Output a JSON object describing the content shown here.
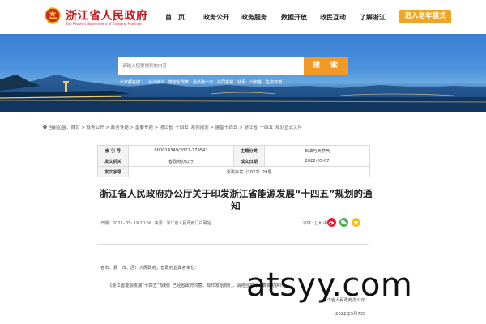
{
  "header": {
    "site_title": "浙江省人民政府",
    "site_subtitle": "The People's Government of Zhejiang Province",
    "nav": [
      "首　页",
      "政务公开",
      "政务服务",
      "数据开放",
      "政民互动",
      "了解浙江"
    ],
    "elder_mode": "进入老年模式"
  },
  "search": {
    "placeholder": "请输入您要搜索的内容",
    "button": "搜　索",
    "hot_label": "大家都在搜：",
    "hot_links": [
      "会计考试",
      "数字化改革",
      "最多跑一次",
      "共同富裕",
      "社保",
      "公积金",
      "生态环境"
    ]
  },
  "breadcrumb": "当前位置：首页 > 政务公开 > 政务专题 > 重要专题 > 浙江省“十四五”系列规划 > 展望十四五 > 浙江省“十四五”规划正式文件",
  "meta": {
    "index_label": "索 引 号",
    "index_value": "000014349/2022-779542",
    "category_label": "主题分类",
    "category_value": "石油与天然气",
    "issuer_label": "发文机关",
    "issuer_value": "省政府办公厅",
    "date_label": "成文日期",
    "date_value": "2022-05-07",
    "number_label": "发文字号",
    "number_value": "浙政办发〔2022〕29号"
  },
  "article": {
    "title": "浙江省人民政府办公厅关于印发浙江省能源发展“十四五”规划的通知",
    "date_info": "日期：2022- 05- 19 10:56",
    "source_info": "来源：浙江省人民政府门户网站",
    "font_size": "字体：[ 大 中 小 ]",
    "salutation": "各市、县（市、区）人民政府，省政府直属各单位：",
    "body": "《浙江省能源发展“十四五”规划》已经省政府同意，现印发给你们，请结合实际认真贯彻执行。",
    "signature": "浙江省人民政府办公厅",
    "sign_date": "2022年5月7日"
  },
  "watermark": "atsyy.com",
  "colors": {
    "brand_red": "#c4161c",
    "accent_orange": "#f29a23",
    "elder_orange": "#f0a623"
  }
}
